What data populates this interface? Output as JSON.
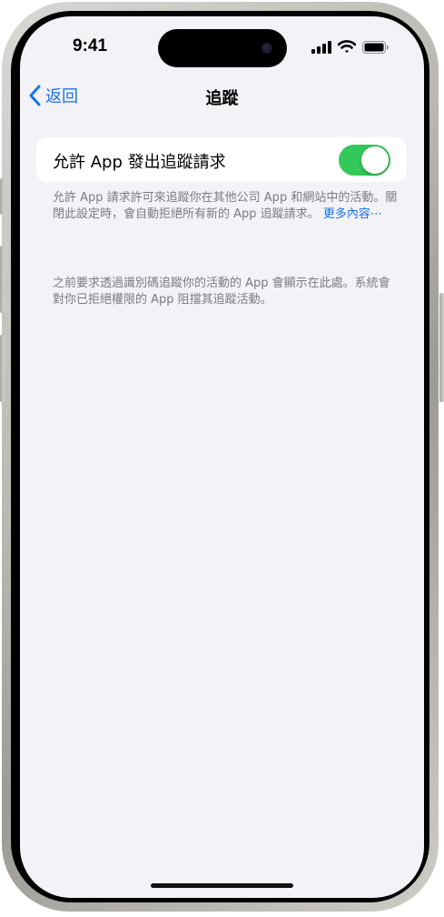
{
  "status_bar": {
    "time": "9:41",
    "icons": [
      "cellular-signal-icon",
      "wifi-icon",
      "battery-icon"
    ]
  },
  "nav": {
    "back_label": "返回",
    "title": "追蹤"
  },
  "setting": {
    "label": "允許 App 發出追蹤請求",
    "enabled": true,
    "toggle_color": "#34c759"
  },
  "description": {
    "text": "允許 App 請求許可來追蹤你在其他公司 App 和網站中的活動。關閉此設定時，會自動拒絕所有新的 App 追蹤請求。",
    "more_link": "更多內容⋯"
  },
  "info_text": "之前要求透過識別碼追蹤你的活動的 App 會顯示在此處。系統會對你已拒絕權限的 App 阻擋其追蹤活動。",
  "colors": {
    "accent": "#1a73e8",
    "background": "#f2f2f7",
    "secondary_text": "#7b7b80"
  }
}
